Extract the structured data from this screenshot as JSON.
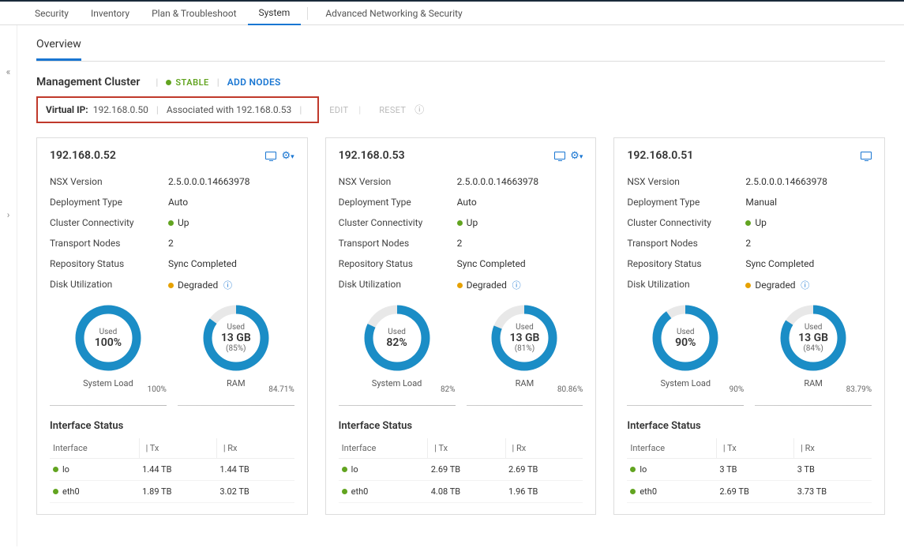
{
  "tabs": {
    "security": "Security",
    "inventory": "Inventory",
    "plan": "Plan & Troubleshoot",
    "system": "System",
    "advanced": "Advanced Networking & Security"
  },
  "subtabs": {
    "overview": "Overview"
  },
  "cluster": {
    "title": "Management Cluster",
    "stable": "STABLE",
    "add_nodes": "ADD NODES"
  },
  "vip": {
    "label": "Virtual IP:",
    "value": "192.168.0.50",
    "assoc": "Associated with 192.168.0.53",
    "edit": "EDIT",
    "reset": "RESET"
  },
  "labels": {
    "nsx_version": "NSX Version",
    "deployment_type": "Deployment Type",
    "cluster_conn": "Cluster Connectivity",
    "transport_nodes": "Transport Nodes",
    "repo_status": "Repository Status",
    "disk_util": "Disk Utilization",
    "used": "Used",
    "system_load": "System Load",
    "ram": "RAM",
    "iface_status": "Interface Status",
    "interface": "Interface",
    "tx": "Tx",
    "rx": "Rx"
  },
  "nodes": [
    {
      "ip": "192.168.0.52",
      "version": "2.5.0.0.0.14663978",
      "deploy": "Auto",
      "conn": "Up",
      "tn": "2",
      "repo": "Sync Completed",
      "disk": "Degraded",
      "load": {
        "pct": 100,
        "text": "100%",
        "spark": "100%"
      },
      "ram": {
        "gb": "13 GB",
        "pct": 85,
        "ptext": "(85%)",
        "spark": "84.71%"
      },
      "show_cog": true,
      "iface": [
        {
          "name": "lo",
          "tx": "1.44 TB",
          "rx": "1.44 TB"
        },
        {
          "name": "eth0",
          "tx": "1.89 TB",
          "rx": "3.02 TB"
        }
      ]
    },
    {
      "ip": "192.168.0.53",
      "version": "2.5.0.0.0.14663978",
      "deploy": "Auto",
      "conn": "Up",
      "tn": "2",
      "repo": "Sync Completed",
      "disk": "Degraded",
      "load": {
        "pct": 82,
        "text": "82%",
        "spark": "82%"
      },
      "ram": {
        "gb": "13 GB",
        "pct": 81,
        "ptext": "(81%)",
        "spark": "80.86%"
      },
      "show_cog": true,
      "iface": [
        {
          "name": "lo",
          "tx": "2.69 TB",
          "rx": "2.69 TB"
        },
        {
          "name": "eth0",
          "tx": "4.08 TB",
          "rx": "1.96 TB"
        }
      ]
    },
    {
      "ip": "192.168.0.51",
      "version": "2.5.0.0.0.14663978",
      "deploy": "Manual",
      "conn": "Up",
      "tn": "2",
      "repo": "Sync Completed",
      "disk": "Degraded",
      "load": {
        "pct": 90,
        "text": "90%",
        "spark": "90%"
      },
      "ram": {
        "gb": "13 GB",
        "pct": 84,
        "ptext": "(84%)",
        "spark": "83.79%"
      },
      "show_cog": false,
      "iface": [
        {
          "name": "lo",
          "tx": "3 TB",
          "rx": "3 TB"
        },
        {
          "name": "eth0",
          "tx": "2.69 TB",
          "rx": "3.73 TB"
        }
      ]
    }
  ]
}
